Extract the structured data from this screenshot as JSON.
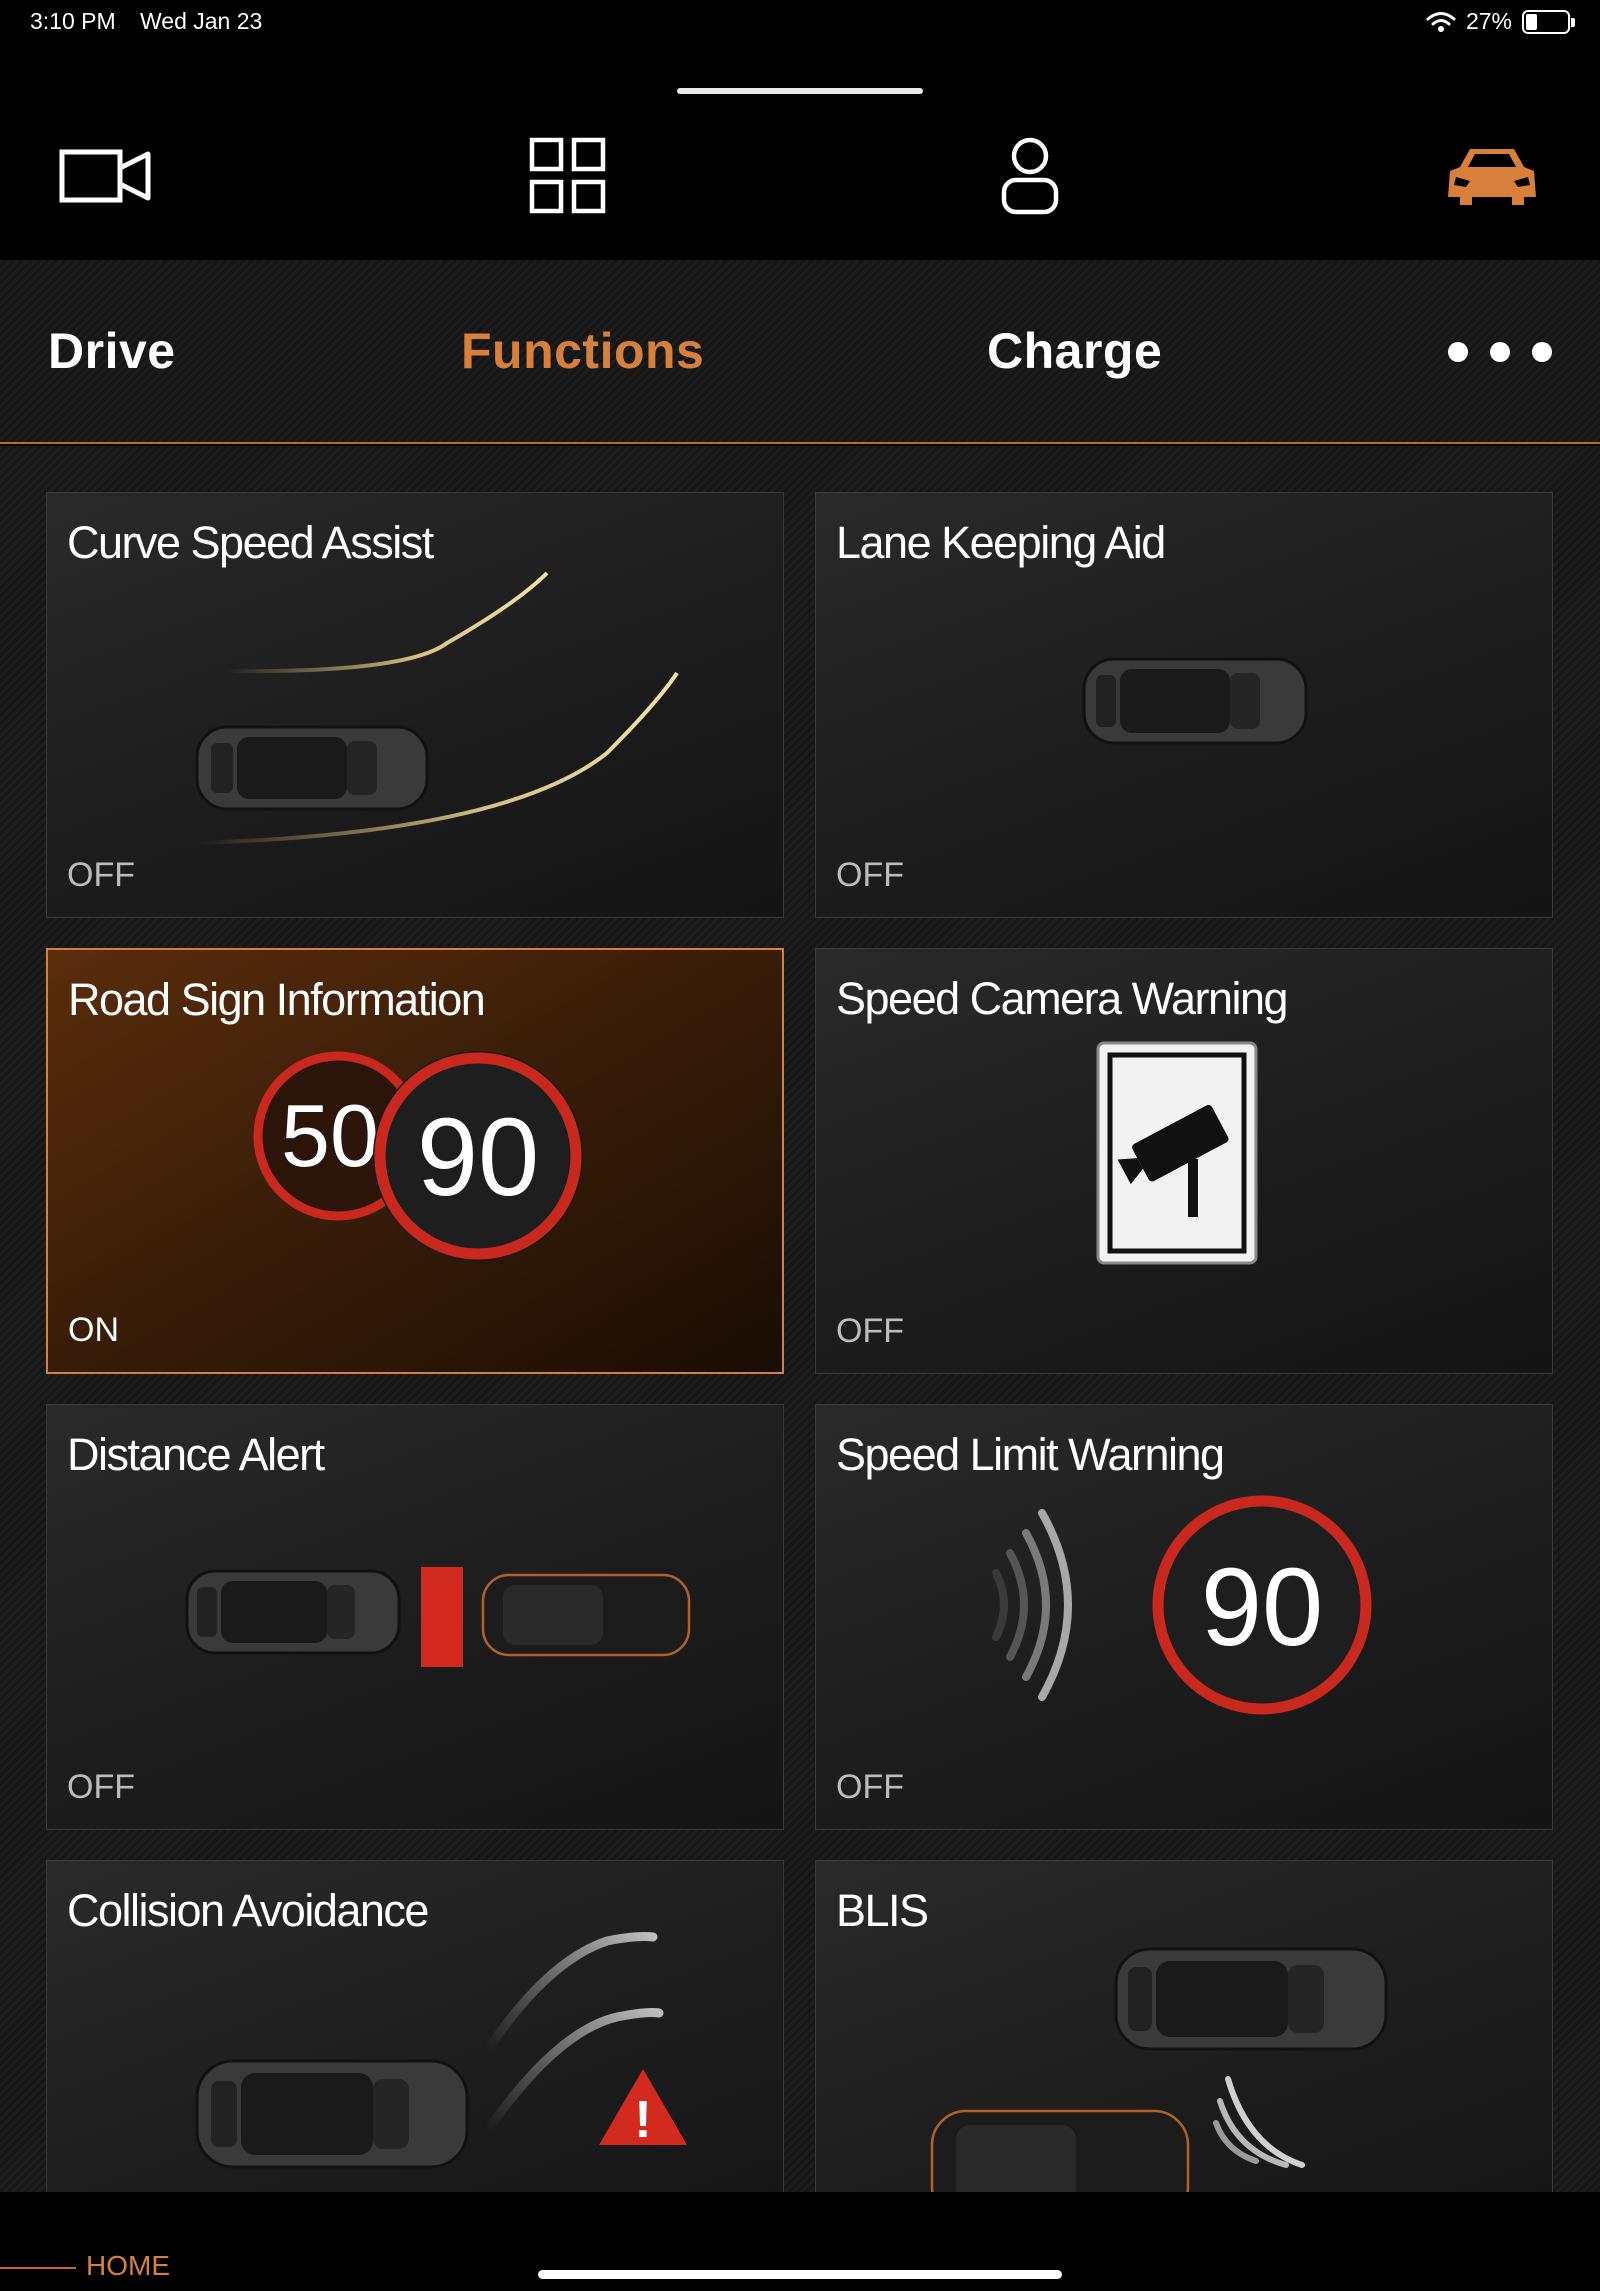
{
  "status_bar": {
    "time": "3:10 PM",
    "date": "Wed Jan 23",
    "battery_percent": "27%",
    "battery_level": 0.27,
    "icons": [
      "wifi-icon",
      "battery-icon"
    ]
  },
  "top_nav": {
    "icons": [
      "camera-icon",
      "grid-icon",
      "profile-icon",
      "car-icon"
    ],
    "active_icon": "car-icon",
    "accent_color": "#d6803c"
  },
  "tabs": [
    {
      "label": "Drive",
      "active": false
    },
    {
      "label": "Functions",
      "active": true
    },
    {
      "label": "Charge",
      "active": false
    }
  ],
  "more_menu": "more-dots-icon",
  "cards": [
    {
      "title": "Curve Speed Assist",
      "state": "OFF"
    },
    {
      "title": "Lane Keeping Aid",
      "state": "OFF"
    },
    {
      "title": "Road Sign Information",
      "state": "ON",
      "sign_back": "50",
      "sign_front": "90"
    },
    {
      "title": "Speed Camera Warning",
      "state": "OFF"
    },
    {
      "title": "Distance Alert",
      "state": "OFF"
    },
    {
      "title": "Speed Limit Warning",
      "state": "OFF",
      "sign": "90"
    },
    {
      "title": "Collision Avoidance",
      "state": "",
      "warning_glyph": "!"
    },
    {
      "title": "BLIS",
      "state": ""
    }
  ],
  "bottom": {
    "home_label": "HOME"
  }
}
